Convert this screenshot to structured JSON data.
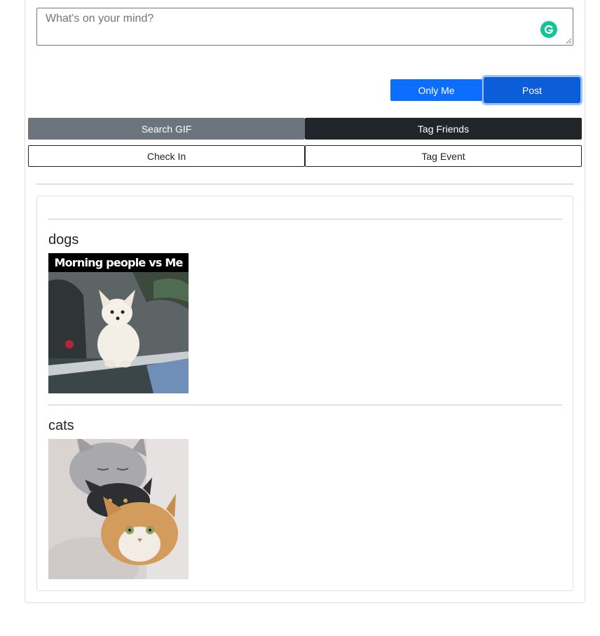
{
  "composer": {
    "placeholder": "What's on your mind?"
  },
  "actions": {
    "only_me_label": "Only Me",
    "post_label": "Post",
    "search_gif_label": "Search GIF",
    "tag_friends_label": "Tag Friends",
    "check_in_label": "Check In",
    "tag_event_label": "Tag Event"
  },
  "feed": {
    "posts": [
      {
        "title": "dogs",
        "gif_caption": "Morning people vs Me"
      },
      {
        "title": "cats"
      }
    ]
  },
  "colors": {
    "primary": "#0d6efd",
    "secondary": "#6c757d",
    "dark": "#212529",
    "grammarly": "#15c39a"
  }
}
